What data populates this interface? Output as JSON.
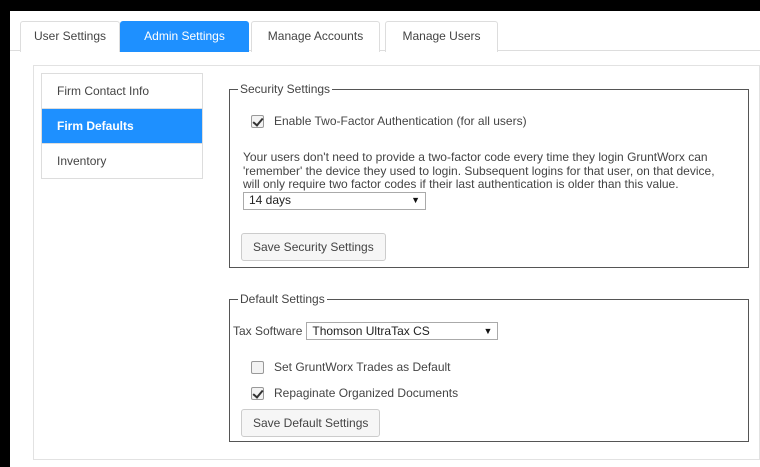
{
  "tabs": [
    {
      "label": "User Settings",
      "active": false
    },
    {
      "label": "Admin Settings",
      "active": true
    },
    {
      "label": "Manage Accounts",
      "active": false
    },
    {
      "label": "Manage Users",
      "active": false
    }
  ],
  "sidebar": {
    "items": [
      {
        "label": "Firm Contact Info",
        "active": false
      },
      {
        "label": "Firm Defaults",
        "active": true
      },
      {
        "label": "Inventory",
        "active": false
      }
    ]
  },
  "security": {
    "legend": "Security Settings",
    "two_factor_label": "Enable Two-Factor Authentication (for all users)",
    "two_factor_checked": true,
    "description": "Your users don't need to provide a two-factor code every time they login GruntWorx can 'remember' the device they used to login. Subsequent logins for that user, on that device, will only require two factor codes if their last authentication is older than this value.",
    "remember_select_value": "14 days",
    "save_button": "Save Security Settings"
  },
  "defaults": {
    "legend": "Default Settings",
    "tax_software_label": "Tax Software",
    "tax_software_value": "Thomson UltraTax CS",
    "trades_label": "Set GruntWorx Trades as Default",
    "trades_checked": false,
    "repaginate_label": "Repaginate Organized Documents",
    "repaginate_checked": true,
    "save_button": "Save Default Settings"
  },
  "colors": {
    "accent": "#1e90ff",
    "frame": "#000000"
  },
  "icons": {
    "checkbox_checked": "checkmark",
    "select_arrow": "triangle-down"
  }
}
